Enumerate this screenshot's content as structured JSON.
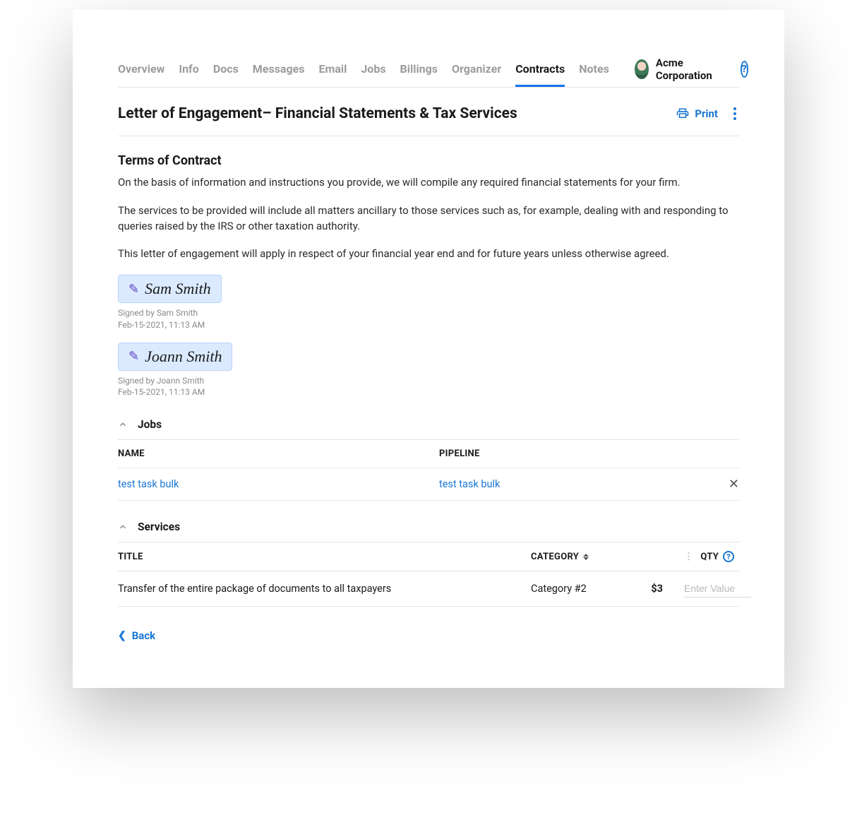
{
  "tabs": [
    {
      "label": "Overview"
    },
    {
      "label": "Info"
    },
    {
      "label": "Docs"
    },
    {
      "label": "Messages"
    },
    {
      "label": "Email"
    },
    {
      "label": "Jobs"
    },
    {
      "label": "Billings"
    },
    {
      "label": "Organizer"
    },
    {
      "label": "Contracts"
    },
    {
      "label": "Notes"
    }
  ],
  "active_tab_index": 8,
  "corp_name": "Acme Corporation",
  "page_title": "Letter of Engagement– Financial Statements & Tax Services",
  "print_label": "Print",
  "terms": {
    "heading": "Terms of Contract",
    "paragraphs": [
      "On the basis of information and instructions you provide, we will compile any required financial statements for your firm.",
      "The services to be provided will include all matters ancillary to those services such as, for example, dealing with and responding to queries raised by the IRS or other taxation authority.",
      "This letter of engagement will apply in respect of your financial year end and for future years unless otherwise agreed."
    ]
  },
  "signatures": [
    {
      "name": "Sam Smith",
      "signed_by": "Signed by Sam Smith",
      "date": "Feb-15-2021, 11:13 AM"
    },
    {
      "name": "Joann Smith",
      "signed_by": "Signed by Joann Smith",
      "date": "Feb-15-2021, 11:13 AM"
    }
  ],
  "jobs": {
    "section_label": "Jobs",
    "columns": {
      "name": "NAME",
      "pipeline": "PIPELINE"
    },
    "rows": [
      {
        "name": "test task bulk",
        "pipeline": "test task bulk"
      }
    ]
  },
  "services": {
    "section_label": "Services",
    "columns": {
      "title": "TITLE",
      "category": "CATEGORY",
      "qty": "QTY"
    },
    "rows": [
      {
        "title": "Transfer of the entire package of documents to all taxpayers",
        "category": "Category #2",
        "price": "$3",
        "qty_placeholder": "Enter Value"
      }
    ]
  },
  "back_label": "Back"
}
